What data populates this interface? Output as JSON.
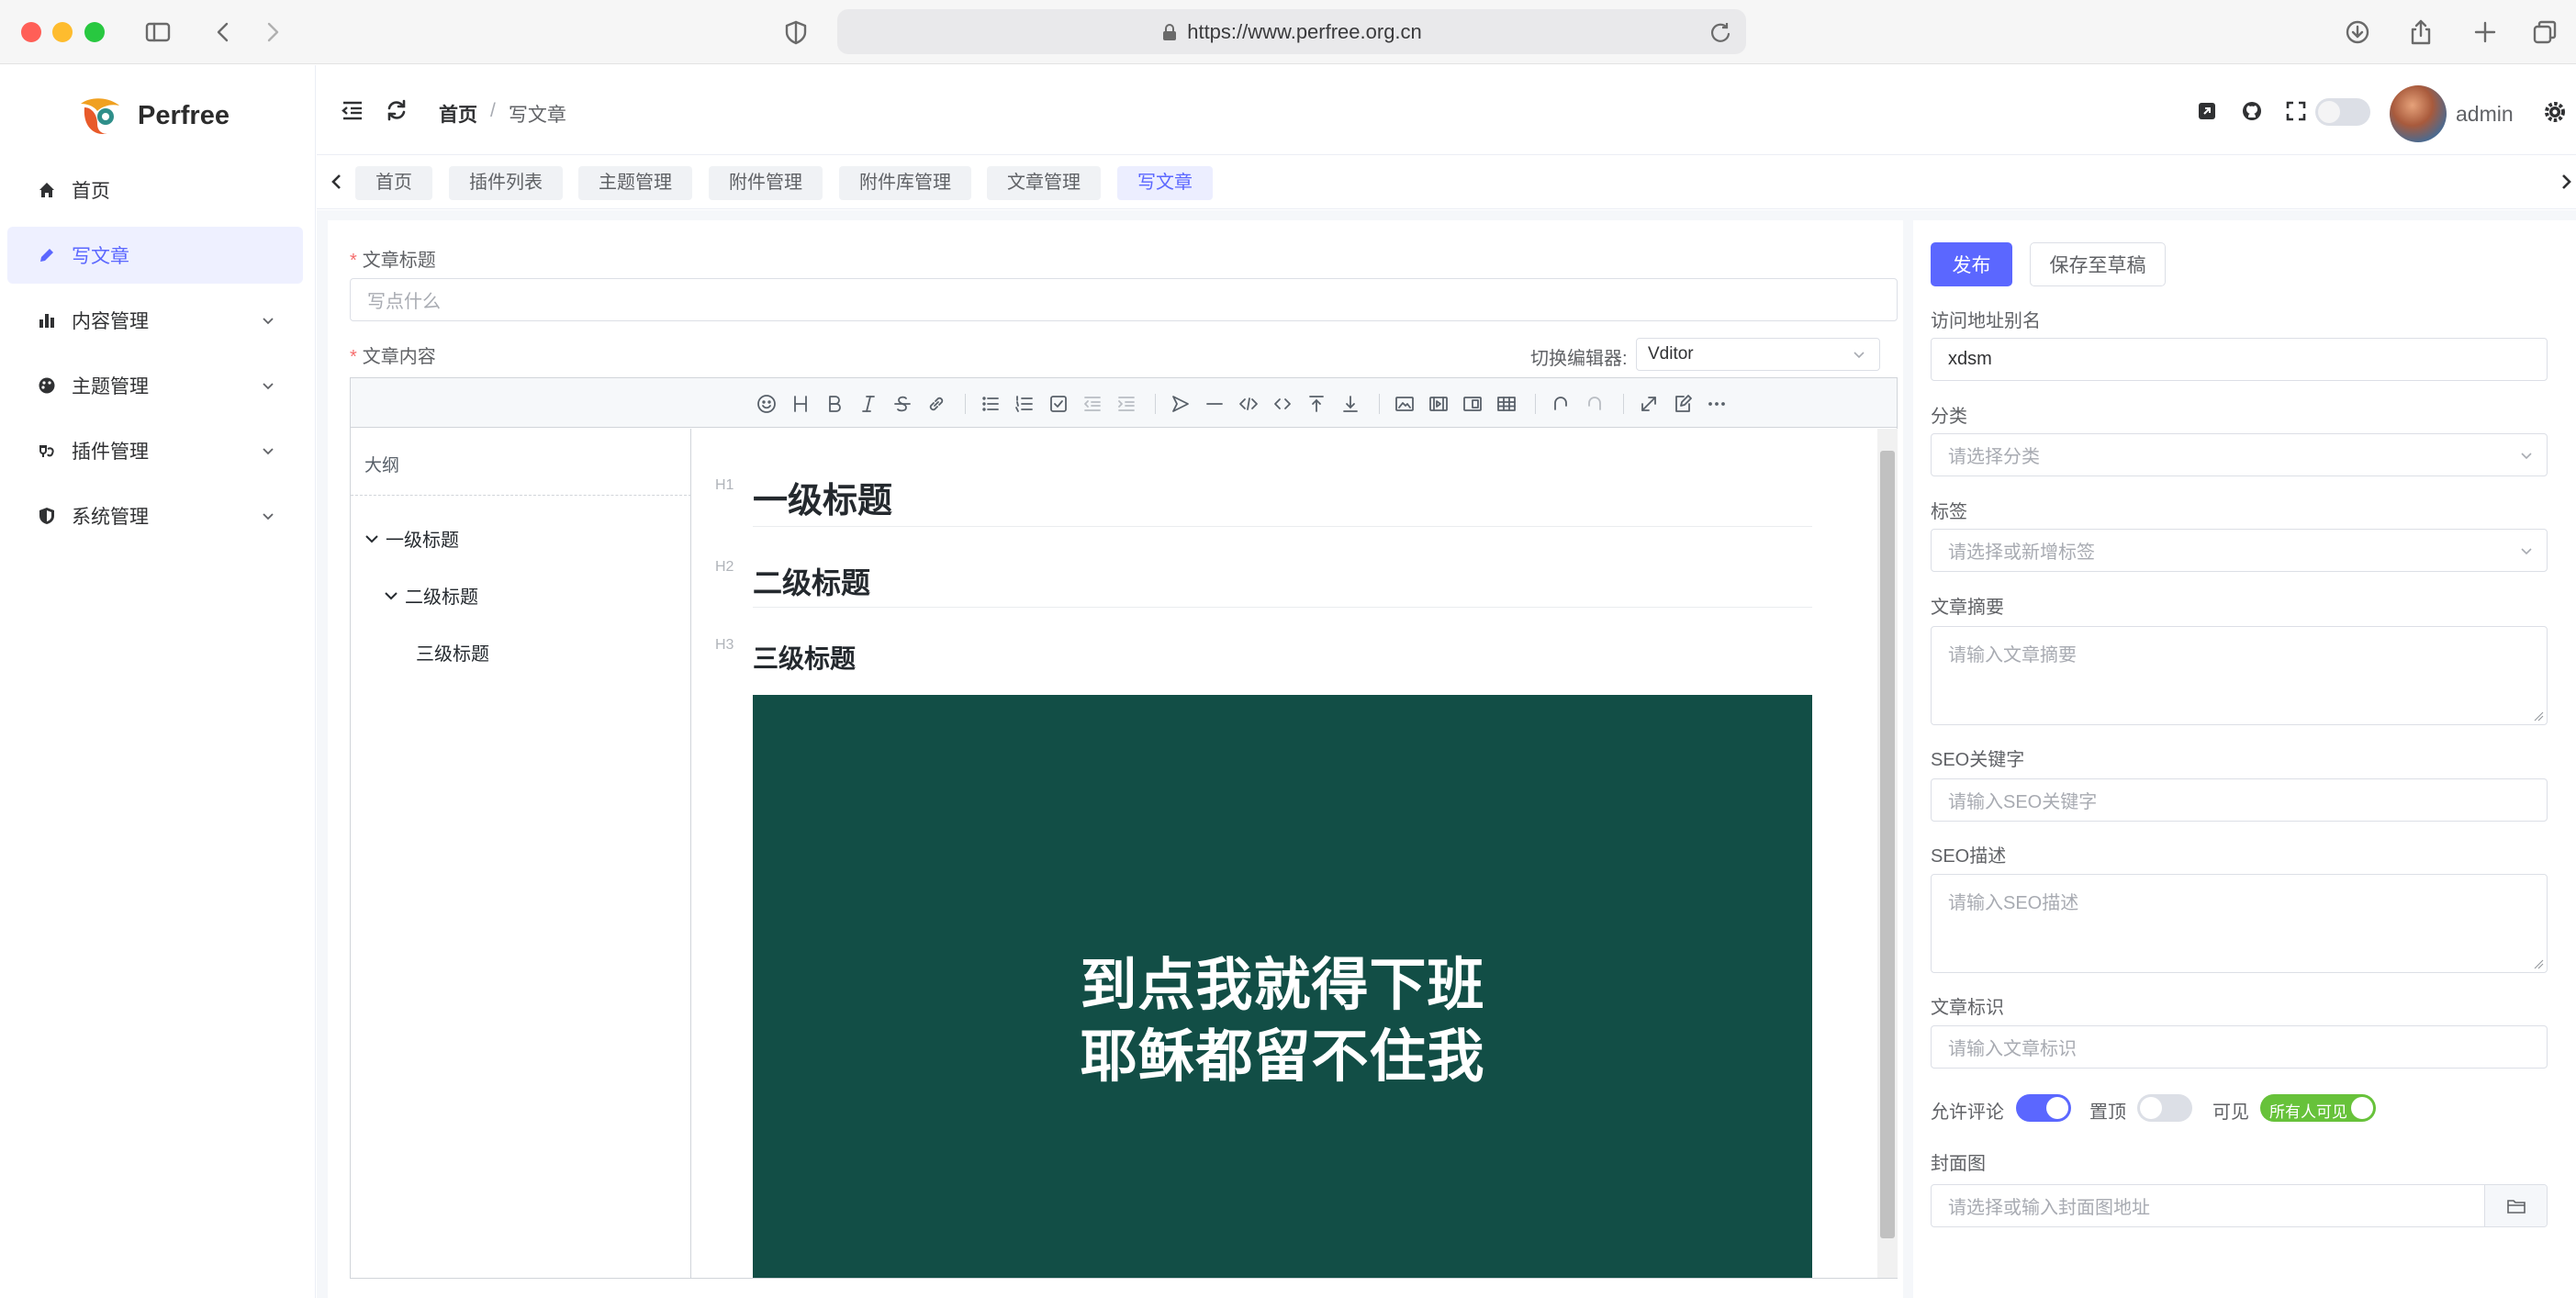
{
  "browser": {
    "url": "https://www.perfree.org.cn"
  },
  "brand": {
    "name": "Perfree"
  },
  "sidebar": {
    "items": [
      {
        "label": "首页",
        "icon": "home-icon"
      },
      {
        "label": "写文章",
        "icon": "pencil-icon",
        "active": true
      },
      {
        "label": "内容管理",
        "icon": "chart-icon",
        "expandable": true
      },
      {
        "label": "主题管理",
        "icon": "palette-icon",
        "expandable": true
      },
      {
        "label": "插件管理",
        "icon": "plugin-icon",
        "expandable": true
      },
      {
        "label": "系统管理",
        "icon": "shield-icon",
        "expandable": true
      }
    ]
  },
  "header": {
    "breadcrumb": {
      "home": "首页",
      "separator": "/",
      "current": "写文章"
    },
    "user": "admin"
  },
  "tabs": [
    {
      "label": "首页"
    },
    {
      "label": "插件列表"
    },
    {
      "label": "主题管理"
    },
    {
      "label": "附件管理"
    },
    {
      "label": "附件库管理"
    },
    {
      "label": "文章管理"
    },
    {
      "label": "写文章",
      "active": true
    }
  ],
  "editor_form": {
    "title_label": "文章标题",
    "title_placeholder": "写点什么",
    "content_label": "文章内容",
    "switch_editor_label": "切换编辑器:",
    "editor_value": "Vditor",
    "outline_title": "大纲",
    "outline": [
      {
        "label": "一级标题",
        "level": 1
      },
      {
        "label": "二级标题",
        "level": 2
      },
      {
        "label": "三级标题",
        "level": 3
      }
    ],
    "headings": [
      {
        "marker": "H1",
        "text": "一级标题"
      },
      {
        "marker": "H2",
        "text": "二级标题"
      },
      {
        "marker": "H3",
        "text": "三级标题"
      }
    ],
    "image_text": [
      "到点我就得下班",
      "耶稣都留不住我"
    ]
  },
  "meta_form": {
    "publish_label": "发布",
    "draft_label": "保存至草稿",
    "slug_label": "访问地址别名",
    "slug_value": "xdsm",
    "category_label": "分类",
    "category_placeholder": "请选择分类",
    "tag_label": "标签",
    "tag_placeholder": "请选择或新增标签",
    "summary_label": "文章摘要",
    "summary_placeholder": "请输入文章摘要",
    "seo_keywords_label": "SEO关键字",
    "seo_keywords_placeholder": "请输入SEO关键字",
    "seo_desc_label": "SEO描述",
    "seo_desc_placeholder": "请输入SEO描述",
    "flag_label": "文章标识",
    "flag_placeholder": "请输入文章标识",
    "allow_comment_label": "允许评论",
    "allow_comment": true,
    "top_label": "置顶",
    "top": false,
    "visible_label": "可见",
    "visible_value": "所有人可见",
    "cover_label": "封面图",
    "cover_placeholder": "请选择或输入封面图地址"
  },
  "colors": {
    "accent": "#5b67ff",
    "success": "#67c23a",
    "image_bg": "#124e46"
  }
}
